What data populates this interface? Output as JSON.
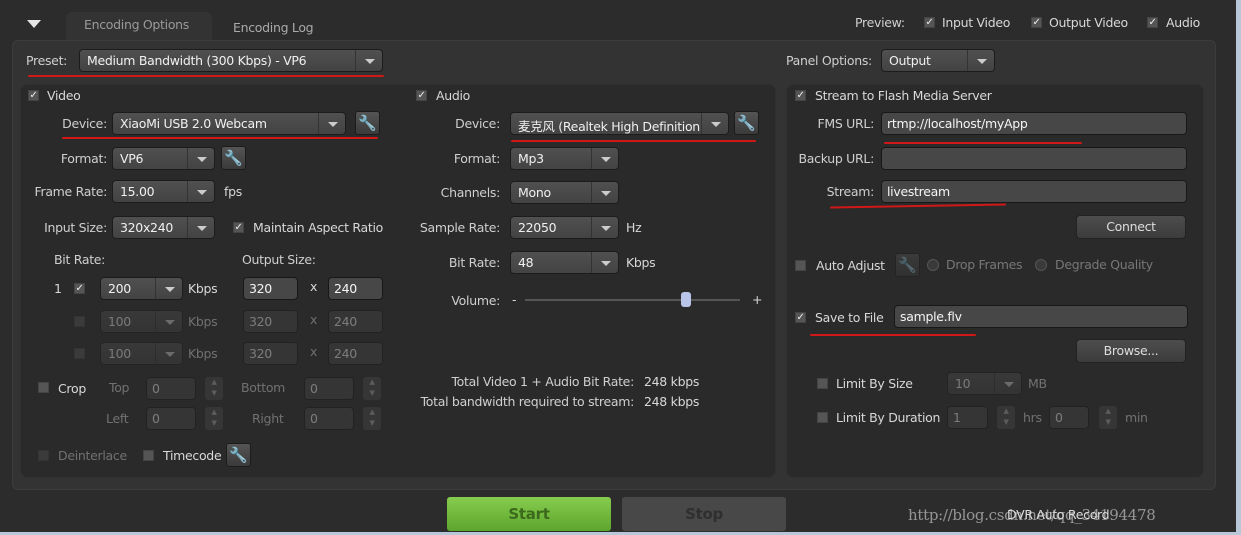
{
  "tabs": {
    "active": "Encoding Options",
    "other": "Encoding Log"
  },
  "preview": {
    "label": "Preview:",
    "input_video": "Input Video",
    "output_video": "Output Video",
    "audio": "Audio",
    "checked": true
  },
  "preset": {
    "label": "Preset:",
    "value": "Medium Bandwidth (300 Kbps) - VP6"
  },
  "panel_options": {
    "label": "Panel Options:",
    "value": "Output"
  },
  "video": {
    "label": "Video",
    "device_label": "Device:",
    "device": "XiaoMi USB 2.0 Webcam",
    "format_label": "Format:",
    "format": "VP6",
    "frame_rate_label": "Frame Rate:",
    "frame_rate": "15.00",
    "fps": "fps",
    "input_size_label": "Input Size:",
    "input_size": "320x240",
    "maintain_aspect": "Maintain Aspect Ratio",
    "bit_rate_label": "Bit Rate:",
    "output_size_label": "Output Size:",
    "x": "x",
    "kbps": "Kbps",
    "rows": [
      {
        "index": "1",
        "bitrate": "200",
        "w": "320",
        "h": "240"
      },
      {
        "bitrate": "100",
        "w": "320",
        "h": "240"
      },
      {
        "bitrate": "100",
        "w": "320",
        "h": "240"
      }
    ],
    "crop": "Crop",
    "top": "Top",
    "bottom": "Bottom",
    "left": "Left",
    "right": "Right",
    "crop_value": "0",
    "deinterlace": "Deinterlace",
    "timecode": "Timecode"
  },
  "audio": {
    "label": "Audio",
    "device_label": "Device:",
    "device": "麦克风 (Realtek High Definition",
    "format_label": "Format:",
    "format": "Mp3",
    "channels_label": "Channels:",
    "channels": "Mono",
    "sample_rate_label": "Sample Rate:",
    "sample_rate": "22050",
    "hz": "Hz",
    "bit_rate_label": "Bit Rate:",
    "bit_rate": "48",
    "kbps": "Kbps",
    "volume_label": "Volume:",
    "minus": "-",
    "plus": "+",
    "volume": 0.75,
    "total_label": "Total Video 1 + Audio Bit Rate:",
    "total_value": "248 kbps",
    "bandwidth_label": "Total bandwidth required to stream:",
    "bandwidth_value": "248 kbps"
  },
  "output": {
    "stream_fms": "Stream to Flash Media Server",
    "fms_url_label": "FMS URL:",
    "fms_url": "rtmp://localhost/myApp",
    "backup_url_label": "Backup URL:",
    "backup_url": "",
    "stream_label": "Stream:",
    "stream": "livestream",
    "connect": "Connect",
    "auto_adjust": "Auto Adjust",
    "drop_frames": "Drop Frames",
    "degrade_quality": "Degrade Quality",
    "save_to_file": "Save to File",
    "file": "sample.flv",
    "browse": "Browse...",
    "limit_size": "Limit By Size",
    "size_value": "10",
    "mb": "MB",
    "limit_duration": "Limit By Duration",
    "hrs_value": "1",
    "hrs": "hrs",
    "min_value": "0",
    "min": "min"
  },
  "footer": {
    "start": "Start",
    "stop": "Stop",
    "dvr": "DVR Auto Record",
    "watermark": "http://blog.csdn.net/qq_34194478"
  },
  "colors": {
    "start_green": "#6cb33a",
    "annotation_red": "#d01818"
  }
}
